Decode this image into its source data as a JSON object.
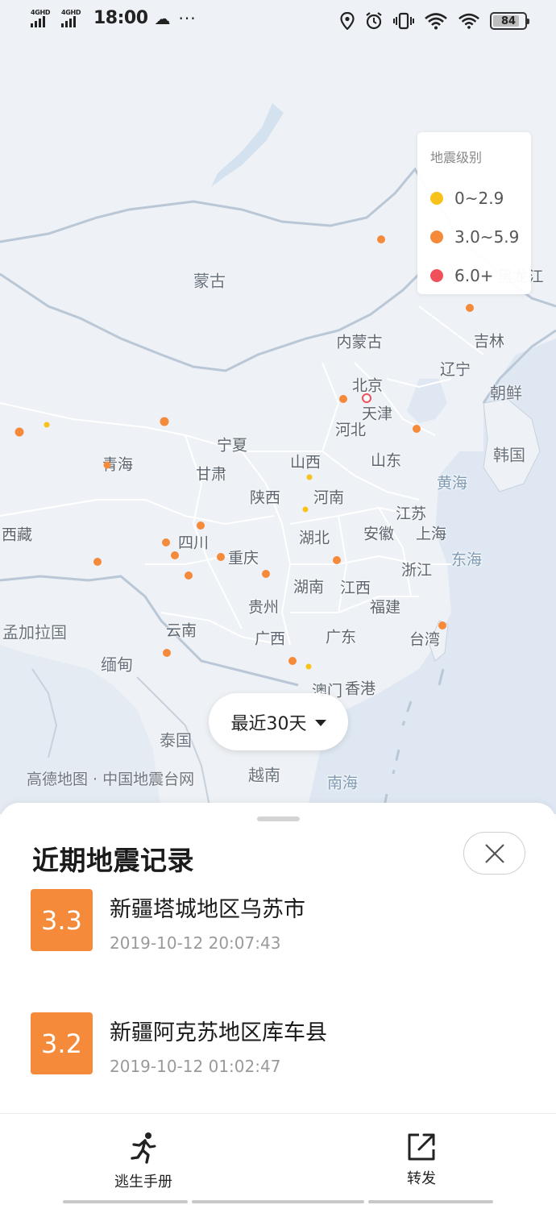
{
  "status_bar": {
    "sim1": "4GHD",
    "sim2": "4GHD",
    "time": "18:00",
    "battery": "84",
    "battery_level": 0.84
  },
  "map": {
    "legend": {
      "title": "地震级别",
      "levels": [
        {
          "label": "0~2.9",
          "color": "#f7c21a"
        },
        {
          "label": "3.0~5.9",
          "color": "#f48a3a"
        },
        {
          "label": "6.0+",
          "color": "#f0505a"
        }
      ]
    },
    "places": {
      "mongolia": "蒙古",
      "inner_mongolia": "内蒙古",
      "heilongjiang_partial": "黑龙江",
      "jilin": "吉林",
      "liaoning": "辽宁",
      "north_korea": "朝鲜",
      "south_korea": "韩国",
      "beijing": "北京",
      "tianjin": "天津",
      "hebei": "河北",
      "ningxia": "宁夏",
      "shanxi": "山西",
      "shandong": "山东",
      "qinghai": "青海",
      "gansu": "甘肃",
      "shaanxi": "陕西",
      "henan": "河南",
      "yellow_sea": "黄海",
      "jiangsu": "江苏",
      "tibet": "西藏",
      "sichuan": "四川",
      "hubei": "湖北",
      "anhui": "安徽",
      "shanghai": "上海",
      "chongqing": "重庆",
      "east_sea": "东海",
      "zhejiang": "浙江",
      "hunan": "湖南",
      "jiangxi": "江西",
      "guizhou": "贵州",
      "fujian": "福建",
      "bangladesh": "孟加拉国",
      "yunnan": "云南",
      "guangxi": "广西",
      "guangdong": "广东",
      "taiwan": "台湾",
      "myanmar": "缅甸",
      "macau": "澳门",
      "hongkong": "香港",
      "thailand": "泰国",
      "vietnam": "越南",
      "south_sea": "南海"
    },
    "attribution": "高德地图 · 中国地震台网",
    "period_button": "最近30天"
  },
  "sheet": {
    "title": "近期地震记录",
    "quakes": [
      {
        "magnitude": "3.3",
        "place": "新疆塔城地区乌苏市",
        "time": "2019-10-12 20:07:43"
      },
      {
        "magnitude": "3.2",
        "place": "新疆阿克苏地区库车县",
        "time": "2019-10-12 01:02:47"
      }
    ]
  },
  "tabs": {
    "escape_manual": "逃生手册",
    "share": "转发"
  }
}
